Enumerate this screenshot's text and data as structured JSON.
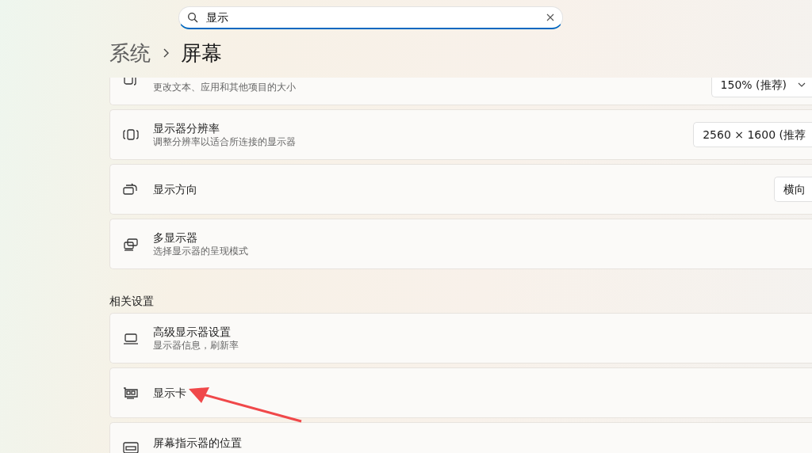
{
  "search": {
    "value": "显示"
  },
  "breadcrumb": [
    {
      "label": "系统"
    },
    {
      "label": "屏幕"
    }
  ],
  "rows": [
    {
      "subtitle": "更改文本、应用和其他项目的大小",
      "control": {
        "value": "150% (推荐)",
        "chevron": true
      }
    },
    {
      "title": "显示器分辨率",
      "subtitle": "调整分辨率以适合所连接的显示器",
      "control": {
        "value": "2560 × 1600 (推荐",
        "chevron": false
      }
    },
    {
      "title": "显示方向",
      "control": {
        "value": "横向",
        "chevron": false
      }
    },
    {
      "title": "多显示器",
      "subtitle": "选择显示器的呈现模式"
    }
  ],
  "related": {
    "heading": "相关设置",
    "rows": [
      {
        "title": "高级显示器设置",
        "subtitle": "显示器信息，刷新率"
      },
      {
        "title": "显示卡"
      },
      {
        "title": "屏幕指示器的位置"
      }
    ]
  }
}
